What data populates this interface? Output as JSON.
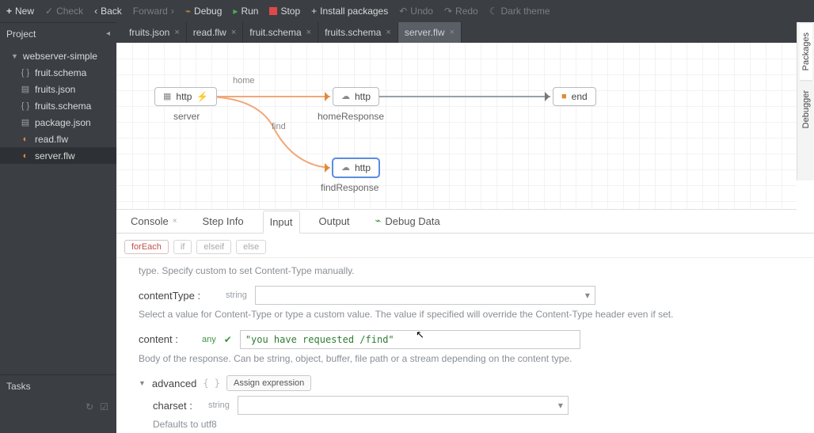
{
  "toolbar": {
    "new": "New",
    "check": "Check",
    "back": "Back",
    "forward": "Forward",
    "debug": "Debug",
    "run": "Run",
    "stop": "Stop",
    "install": "Install packages",
    "undo": "Undo",
    "redo": "Redo",
    "theme": "Dark theme"
  },
  "sidebar": {
    "project_header": "Project",
    "tasks_header": "Tasks",
    "tree": {
      "root": "webserver-simple",
      "items": [
        {
          "icon": "{ }",
          "label": "fruit.schema"
        },
        {
          "icon": "▤",
          "label": "fruits.json"
        },
        {
          "icon": "{ }",
          "label": "fruits.schema"
        },
        {
          "icon": "▤",
          "label": "package.json"
        },
        {
          "icon": "◐",
          "label": "read.flw"
        },
        {
          "icon": "◐",
          "label": "server.flw"
        }
      ]
    }
  },
  "tabs": [
    {
      "label": "fruits.json"
    },
    {
      "label": "read.flw"
    },
    {
      "label": "fruit.schema"
    },
    {
      "label": "fruits.schema"
    },
    {
      "label": "server.flw",
      "selected": true
    }
  ],
  "rail": {
    "packages": "Packages",
    "debugger": "Debugger"
  },
  "graph": {
    "server": {
      "text": "http",
      "label": "server"
    },
    "homeResponse": {
      "text": "http",
      "label": "homeResponse"
    },
    "findResponse": {
      "text": "http",
      "label": "findResponse"
    },
    "end": {
      "text": "end"
    },
    "edges": {
      "home": "home",
      "find": "find"
    }
  },
  "lowerTabs": {
    "console": "Console",
    "stepInfo": "Step Info",
    "input": "Input",
    "output": "Output",
    "debugData": "Debug Data"
  },
  "chips": {
    "forEach": "forEach",
    "if": "if",
    "elseif": "elseif",
    "else": "else"
  },
  "form": {
    "help0": "type. Specify custom to set Content-Type manually.",
    "contentType_label": "contentType :",
    "contentType_type": "string",
    "contentType_help": "Select a value for Content-Type or type a custom value. The value if specified will override the Content-Type header even if set.",
    "content_label": "content :",
    "content_type": "any",
    "content_value": "\"you have requested /find\"",
    "content_help": "Body of the response. Can be string, object, buffer, file path or a stream depending on the content type.",
    "advanced_label": "advanced",
    "braces": "{ }",
    "assign": "Assign expression",
    "charset_label": "charset :",
    "charset_type": "string",
    "charset_help": "Defaults to utf8"
  }
}
